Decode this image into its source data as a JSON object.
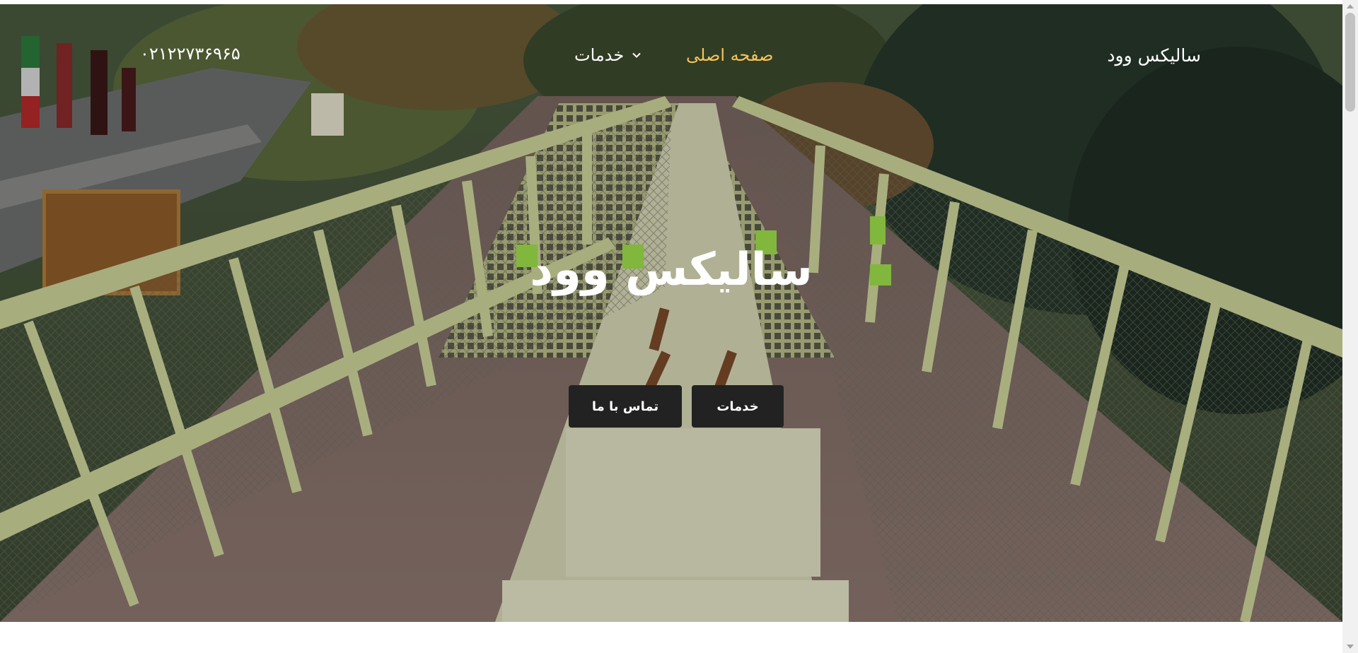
{
  "header": {
    "brand": "سالیکس وود",
    "nav": {
      "home": "صفحه اصلی",
      "services": "خدمات",
      "services_icon": "chevron-down-icon"
    },
    "phone": "۰۲۱۲۲۷۳۶۹۶۵"
  },
  "hero": {
    "title": "سالیکس وود",
    "buttons": {
      "services": "خدمات",
      "contact": "تماس با ما"
    },
    "background": "pedestrian-bridge-photo"
  },
  "colors": {
    "nav_active": "#f6c35b",
    "button_bg": "#222222",
    "text": "#ffffff"
  }
}
